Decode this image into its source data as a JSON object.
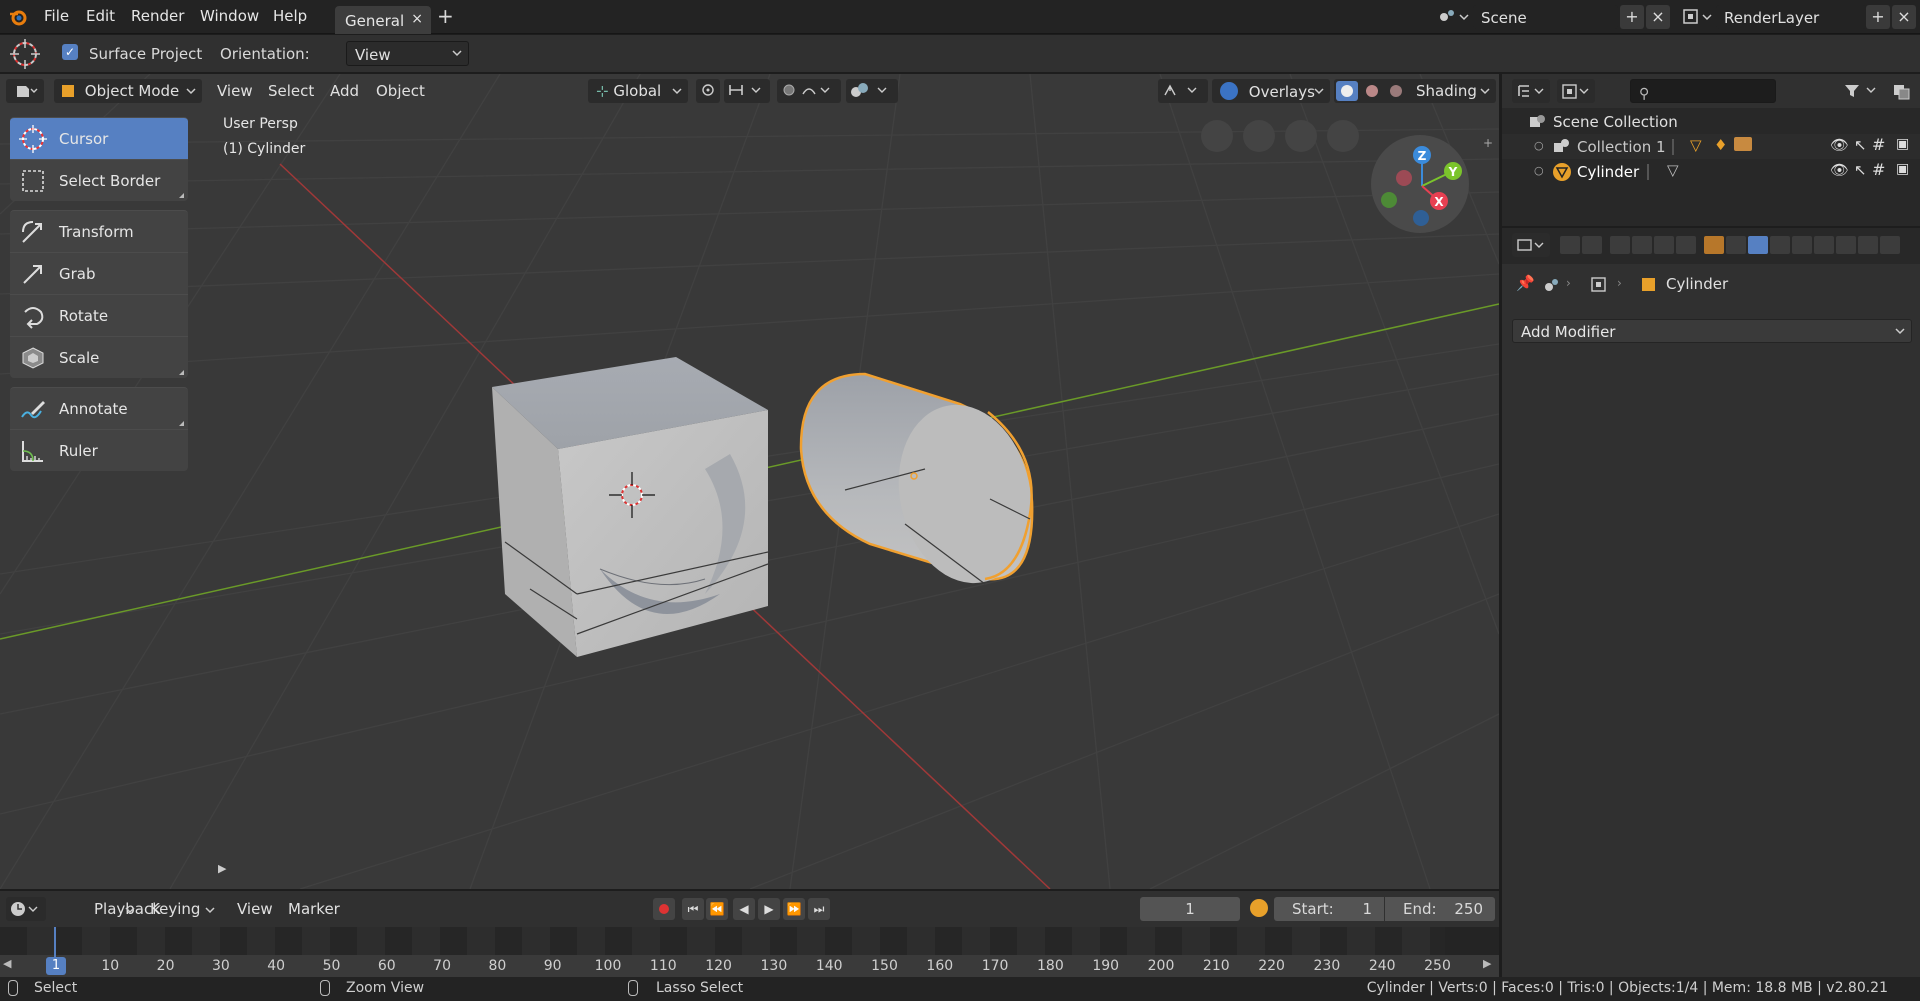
{
  "topbar": {
    "menus": [
      "File",
      "Edit",
      "Render",
      "Window",
      "Help"
    ],
    "workspace_tab": "General",
    "add_tab": "+",
    "scene": {
      "label": "Scene",
      "add": "+",
      "remove": "×"
    },
    "render_layer": {
      "label": "RenderLayer",
      "add": "+",
      "remove": "×"
    }
  },
  "tool_settings": {
    "surface_project": "Surface Project",
    "surface_project_checked": true,
    "orientation_label": "Orientation:",
    "orientation_value": "View"
  },
  "viewport_header": {
    "mode": "Object Mode",
    "menus": [
      "View",
      "Select",
      "Add",
      "Object"
    ],
    "transform_orientation": "Global",
    "overlays": "Overlays",
    "shading": "Shading"
  },
  "viewport": {
    "view_name": "User Persp",
    "active_object": "(1) Cylinder",
    "gizmo_axes": {
      "x": "X",
      "y": "Y",
      "z": "Z"
    }
  },
  "toolbar": {
    "tools": [
      {
        "label": "Cursor",
        "icon": "cursor-icon",
        "active": true
      },
      {
        "label": "Select Border",
        "icon": "select-border-icon",
        "active": false
      },
      {
        "label": "Transform",
        "icon": "transform-icon",
        "active": false
      },
      {
        "label": "Grab",
        "icon": "grab-icon",
        "active": false
      },
      {
        "label": "Rotate",
        "icon": "rotate-icon",
        "active": false
      },
      {
        "label": "Scale",
        "icon": "scale-icon",
        "active": false
      },
      {
        "label": "Annotate",
        "icon": "annotate-icon",
        "active": false
      },
      {
        "label": "Ruler",
        "icon": "ruler-icon",
        "active": false
      }
    ]
  },
  "outliner": {
    "root": "Scene Collection",
    "items": [
      {
        "label": "Collection 1",
        "icon": "collection-icon"
      },
      {
        "label": "Cylinder",
        "icon": "mesh-icon"
      }
    ]
  },
  "properties": {
    "breadcrumb_object": "Cylinder",
    "add_modifier": "Add Modifier"
  },
  "timeline": {
    "menus": [
      "Playback",
      "Keying",
      "View",
      "Marker"
    ],
    "current_frame": "1",
    "start_label": "Start:",
    "start_value": "1",
    "end_label": "End:",
    "end_value": "250",
    "ruler_ticks": [
      "10",
      "20",
      "30",
      "40",
      "50",
      "60",
      "70",
      "80",
      "90",
      "100",
      "110",
      "120",
      "130",
      "140",
      "150",
      "160",
      "170",
      "180",
      "190",
      "200",
      "210",
      "220",
      "230",
      "240",
      "250"
    ],
    "playhead_label": "1"
  },
  "statusbar": {
    "select": "Select",
    "zoom_view": "Zoom View",
    "lasso_select": "Lasso Select",
    "stats": "Cylinder | Verts:0 | Faces:0 | Tris:0 | Objects:1/4 | Mem: 18.8 MB | v2.80.21"
  },
  "colors": {
    "accent": "#5680c2",
    "selection_outline": "#f0a030",
    "x_axis": "#a03838",
    "y_axis": "#6a9a28",
    "gizmo_z": "#3b8bdb",
    "gizmo_y": "#7bc42c",
    "gizmo_x": "#e84052"
  }
}
